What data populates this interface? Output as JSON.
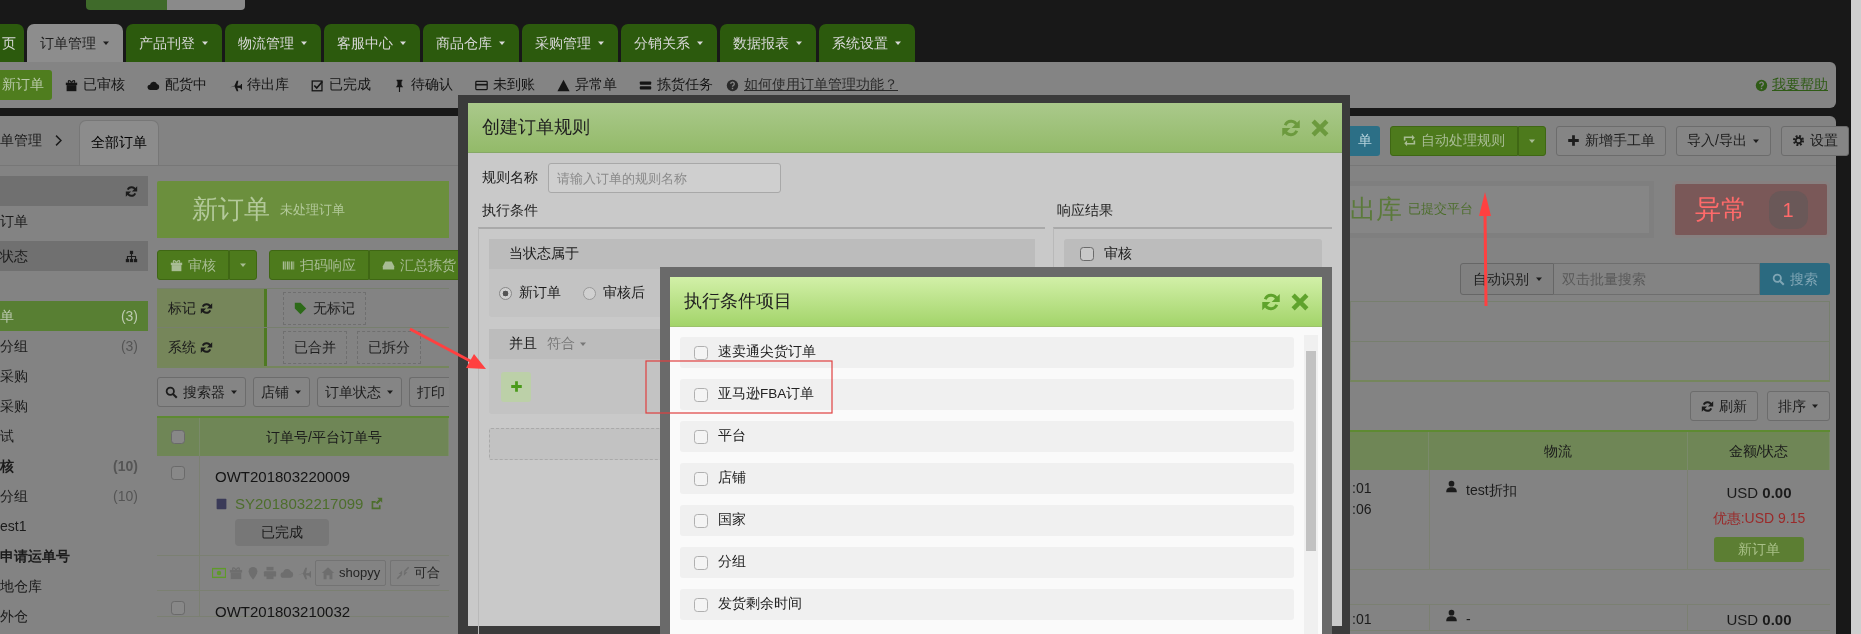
{
  "nav_tabs": [
    {
      "label": "页",
      "selected": false,
      "dropdown": false
    },
    {
      "label": "订单管理",
      "selected": true,
      "dropdown": true
    },
    {
      "label": "产品刊登",
      "selected": false,
      "dropdown": true
    },
    {
      "label": "物流管理",
      "selected": false,
      "dropdown": true
    },
    {
      "label": "客服中心",
      "selected": false,
      "dropdown": true
    },
    {
      "label": "商品仓库",
      "selected": false,
      "dropdown": true
    },
    {
      "label": "采购管理",
      "selected": false,
      "dropdown": true
    },
    {
      "label": "分销关系",
      "selected": false,
      "dropdown": true
    },
    {
      "label": "数据报表",
      "selected": false,
      "dropdown": true
    },
    {
      "label": "系统设置",
      "selected": false,
      "dropdown": true
    }
  ],
  "subnav": {
    "items": [
      {
        "label": "新订单",
        "selected": true
      },
      {
        "label": "已审核",
        "selected": false
      },
      {
        "label": "配货中",
        "selected": false
      },
      {
        "label": "待出库",
        "selected": false
      },
      {
        "label": "已完成",
        "selected": false
      },
      {
        "label": "待确认",
        "selected": false
      },
      {
        "label": "未到账",
        "selected": false
      },
      {
        "label": "异常单",
        "selected": false
      },
      {
        "label": "拣货任务",
        "selected": false
      }
    ],
    "help_link": "如何使用订单管理功能？",
    "help_right": "我要帮助"
  },
  "breadcrumb": {
    "parent": "单管理",
    "tab": "全部订单"
  },
  "toolbar_right": [
    {
      "kind": "cut",
      "label": "单"
    },
    {
      "kind": "split",
      "label": "自动处理规则"
    },
    {
      "kind": "plain",
      "label": "新增手工单"
    },
    {
      "kind": "dropdown",
      "label": "导入/导出"
    },
    {
      "kind": "plain",
      "label": "设置"
    }
  ],
  "sidebar": [
    {
      "kind": "header"
    },
    {
      "kind": "item",
      "label": "订单",
      "selected": false
    },
    {
      "kind": "header",
      "label": "状态"
    },
    {
      "kind": "blank"
    },
    {
      "kind": "item",
      "label": "单",
      "count": "(3)",
      "selected": true
    },
    {
      "kind": "item",
      "label": "分组",
      "count": "(3)",
      "selected": false
    },
    {
      "kind": "item",
      "label": "采购",
      "selected": false
    },
    {
      "kind": "item",
      "label": "采购",
      "selected": false
    },
    {
      "kind": "item",
      "label": "试",
      "selected": false
    },
    {
      "kind": "group",
      "label": "核",
      "count": "(10)",
      "selected": false
    },
    {
      "kind": "item",
      "label": "分组",
      "count": "(10)",
      "selected": false
    },
    {
      "kind": "item",
      "label": "est1",
      "selected": false
    },
    {
      "kind": "group",
      "label": "申请运单号",
      "selected": false
    },
    {
      "kind": "item",
      "label": "地仓库",
      "selected": false
    },
    {
      "kind": "item",
      "label": "外仓",
      "selected": false
    }
  ],
  "status_cards": [
    {
      "kind": "new",
      "title": "新订单",
      "subtitle": "未处理订单"
    },
    {
      "kind": "cut",
      "title": "出库",
      "subtitle": "已提交平台"
    },
    {
      "kind": "alert",
      "title": "异常",
      "count": "1"
    }
  ],
  "action_buttons": [
    {
      "kind": "split",
      "label": "审核"
    },
    {
      "kind": "group",
      "label": "扫码响应"
    },
    {
      "kind": "group",
      "label": "汇总拣货"
    }
  ],
  "filters": [
    {
      "label": "标记",
      "tags": [
        "无标记"
      ]
    },
    {
      "label": "系统",
      "tags": [
        "已合并",
        "已拆分"
      ]
    }
  ],
  "list_tools": [
    {
      "label": "搜索器",
      "dropdown": true
    },
    {
      "label": "店铺",
      "dropdown": true
    },
    {
      "label": "订单状态",
      "dropdown": true
    },
    {
      "label": "打印",
      "dropdown": false
    }
  ],
  "search": {
    "mode": "自动识别",
    "placeholder": "双击批量搜索",
    "button": "搜索"
  },
  "list_tools_right": [
    {
      "label": "刷新",
      "dropdown": false
    },
    {
      "label": "排序",
      "dropdown": true
    }
  ],
  "table": {
    "select_all": {
      "checked": false
    },
    "columns": [
      "订单号/平台订单号",
      "物流",
      "金额/状态"
    ],
    "rows": [
      {
        "checked": false,
        "order_no": "OWT201803220009",
        "platform_no": "SY2018032217099",
        "status": "已完成",
        "time_1": ":01",
        "time_2": ":06",
        "logistics": "test折扣",
        "amount": "USD **0.00**",
        "discount": "优惠:USD 9.15",
        "badge": "新订单",
        "tags": [
          "shopyy",
          "可合"
        ]
      },
      {
        "checked": false,
        "order_no": "OWT201803210032",
        "time_1": ":01",
        "logistics": "-",
        "amount": "USD **0.00**"
      }
    ]
  },
  "modal": {
    "title": "创建订单规则",
    "name_label": "规则名称",
    "name_placeholder": "请输入订单的规则名称",
    "conditions_label": "执行条件",
    "results_label": "响应结果",
    "status_box": {
      "title": "当状态属于",
      "options": [
        {
          "label": "新订单",
          "selected": true
        },
        {
          "label": "审核后",
          "selected": false
        }
      ]
    },
    "logic": {
      "label": "并且",
      "mode": "符合"
    },
    "results": [
      {
        "label": "审核",
        "checked": false
      }
    ]
  },
  "picker": {
    "title": "执行条件项目",
    "items": [
      {
        "label": "速卖通尖货订单",
        "checked": false
      },
      {
        "label": "亚马逊FBA订单",
        "checked": false
      },
      {
        "label": "平台",
        "checked": false
      },
      {
        "label": "店铺",
        "checked": false
      },
      {
        "label": "国家",
        "checked": false
      },
      {
        "label": "分组",
        "checked": false
      },
      {
        "label": "发货剩余时间",
        "checked": false
      }
    ]
  }
}
